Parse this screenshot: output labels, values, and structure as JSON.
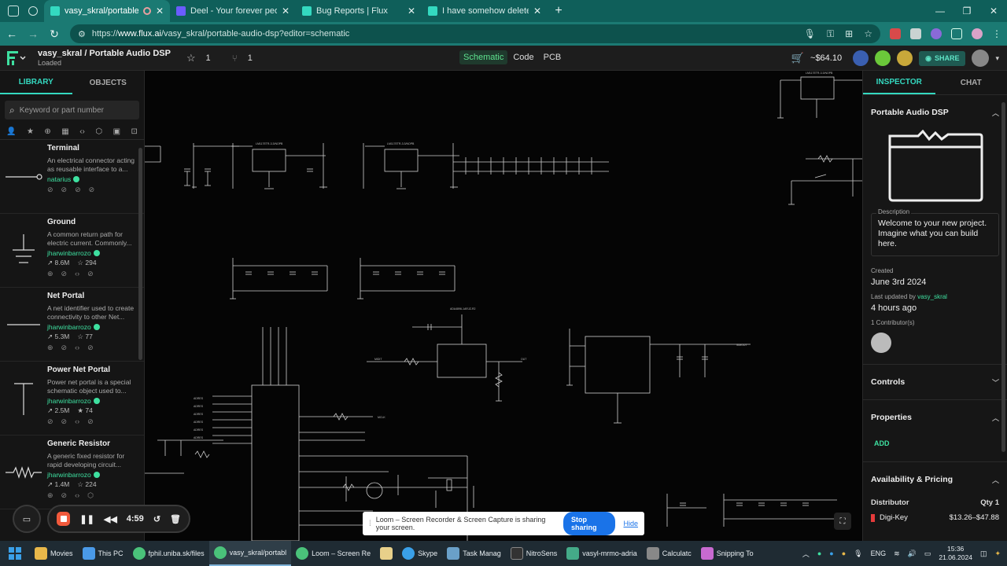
{
  "browser": {
    "tabs": [
      {
        "title": "vasy_skral/portable-audio-d",
        "active": true,
        "recording": true
      },
      {
        "title": "Deel - Your forever people platf",
        "active": false
      },
      {
        "title": "Bug Reports | Flux",
        "active": false
      },
      {
        "title": "I have somehow deleted my PC",
        "active": false
      }
    ],
    "new_tab": "+",
    "url_prefix": "https://",
    "url_host": "www.flux.ai",
    "url_path": "/vasy_skral/portable-audio-dsp?editor=schematic"
  },
  "app": {
    "project_path": "vasy_skral / Portable Audio DSP",
    "project_status": "Loaded",
    "star_count": "1",
    "fork_count": "1",
    "modes": [
      "Schematic",
      "Code",
      "PCB"
    ],
    "active_mode": "Schematic",
    "cart_price": "~$64.10",
    "share_label": "SHARE"
  },
  "library": {
    "tabs": [
      "LIBRARY",
      "OBJECTS"
    ],
    "search_placeholder": "Keyword or part number",
    "parts": [
      {
        "name": "Terminal",
        "desc": "An electrical connector acting as reusable interface to a...",
        "author": "natarius",
        "usage": "",
        "stars": ""
      },
      {
        "name": "Ground",
        "desc": "A common return path for electric current. Commonly...",
        "author": "jharwinbarrozo",
        "usage": "8.6M",
        "stars": "294"
      },
      {
        "name": "Net Portal",
        "desc": "A net identifier used to create connectivity to other Net...",
        "author": "jharwinbarrozo",
        "usage": "5.3M",
        "stars": "77"
      },
      {
        "name": "Power Net Portal",
        "desc": "Power net portal is a special schematic object used to...",
        "author": "jharwinbarrozo",
        "usage": "2.5M",
        "stars": "74"
      },
      {
        "name": "Generic Resistor",
        "desc": "A generic fixed resistor for rapid developing circuit...",
        "author": "jharwinbarrozo",
        "usage": "1.4M",
        "stars": "224"
      }
    ]
  },
  "inspector": {
    "tabs": [
      "INSPECTOR",
      "CHAT"
    ],
    "project_title": "Portable Audio DSP",
    "description_label": "Description",
    "description": "Welcome to your new project. Imagine what you can build here.",
    "created_label": "Created",
    "created": "June 3rd 2024",
    "updated_label": "Last updated by",
    "updated_by": "vasy_skral",
    "updated_ago": "4 hours ago",
    "contributors": "1 Contributor(s)",
    "controls": "Controls",
    "properties": "Properties",
    "add_label": "ADD",
    "availability": "Availability & Pricing",
    "distributor_label": "Distributor",
    "qty_label": "Qty 1",
    "distributor": "Digi-Key",
    "price_range": "$13.26–$47.88"
  },
  "recorder": {
    "timer": "4:59",
    "banner_text": "Loom – Screen Recorder & Screen Capture is sharing your screen.",
    "stop_label": "Stop sharing",
    "hide_label": "Hide"
  },
  "taskbar": {
    "items": [
      {
        "label": "Movies",
        "color": "#e8b84a"
      },
      {
        "label": "This PC",
        "color": "#4a9ae8"
      },
      {
        "label": "fphil.uniba.sk/files",
        "color": "#4ac27a"
      },
      {
        "label": "vasy_skral/portabl",
        "color": "#4ac27a",
        "active": true
      },
      {
        "label": "Loom – Screen Re",
        "color": "#4ac27a"
      },
      {
        "label": "",
        "color": "#e8d08a"
      },
      {
        "label": "Skype",
        "color": "#3aa0e8"
      },
      {
        "label": "Task Manag",
        "color": "#6aa0c8"
      },
      {
        "label": "NitroSens",
        "color": "#333333"
      },
      {
        "label": "vasyl-mrmo-adria",
        "color": "#44aa88"
      },
      {
        "label": "Calculatc",
        "color": "#888888"
      },
      {
        "label": "Snipping To",
        "color": "#c86ad0"
      }
    ],
    "lang": "ENG",
    "time": "15:36",
    "date": "21.06.2024"
  },
  "colors": {
    "accent": "#34d9c0",
    "green": "#3ee0a0",
    "browser_teal": "#1b7a73"
  }
}
